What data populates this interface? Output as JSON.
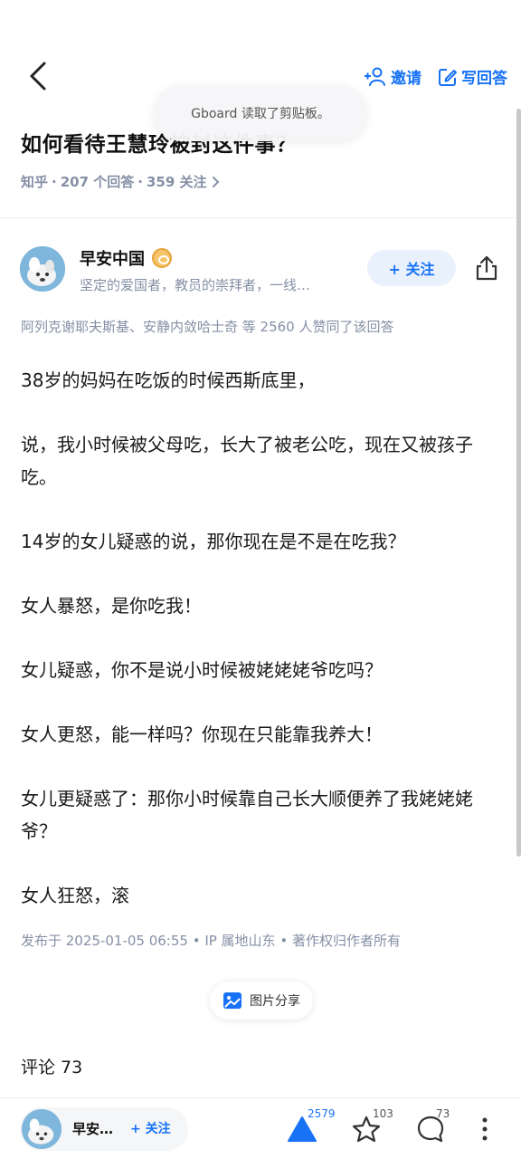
{
  "toolbar": {
    "invite_label": "邀请",
    "write_label": "写回答"
  },
  "toast": {
    "text": "Gboard 读取了剪贴板。"
  },
  "question": {
    "title": "如何看待王慧玲被封这件事？",
    "source": "知乎",
    "answers": "207 个回答",
    "followers": "359 关注",
    "separator": "·"
  },
  "author": {
    "name": "早安中国",
    "bio": "坚定的爱国者，教员的崇拜者，一线…",
    "follow_label": "+ 关注"
  },
  "voters": {
    "text": "阿列克谢耶夫斯基、安静内敛哈士奇 等 2560 人赞同了该回答"
  },
  "answer": {
    "paragraphs": [
      "38岁的妈妈在吃饭的时候西斯底里，",
      "说，我小时候被父母吃，长大了被老公吃，现在又被孩子吃。",
      "14岁的女儿疑惑的说，那你现在是不是在吃我？",
      "女人暴怒，是你吃我！",
      "女儿疑惑，你不是说小时候被姥姥姥爷吃吗？",
      "女人更怒，能一样吗？你现在只能靠我养大！",
      "女儿更疑惑了：那你小时候靠自己长大顺便养了我姥姥姥爷？",
      "女人狂怒，滚"
    ],
    "publish_info": "发布于 2025-01-05 06:55 • IP 属地山东 • 著作权归作者所有",
    "image_share_label": "图片分享"
  },
  "comments": {
    "title": "评论 73"
  },
  "bottom_bar": {
    "author_short": "早安…",
    "follow_label": "+ 关注",
    "upvote_count": "2579",
    "favorite_count": "103",
    "comment_count": "73"
  },
  "colors": {
    "accent": "#1772f6",
    "meta_grey": "#8590a6"
  }
}
